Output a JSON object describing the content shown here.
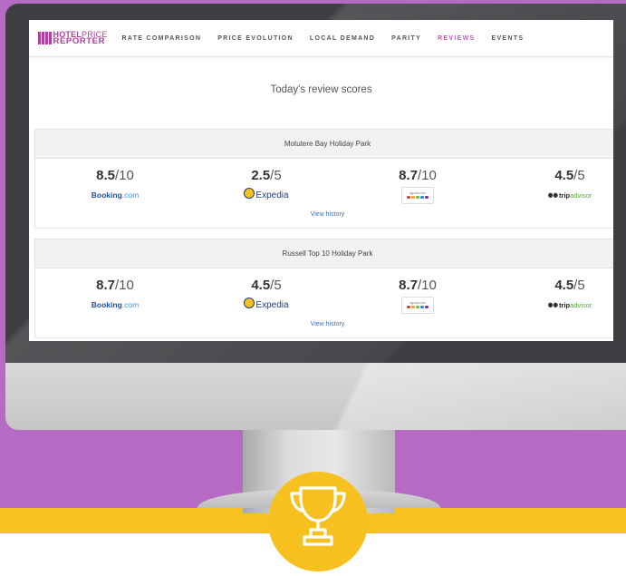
{
  "logo": {
    "line1_bold": "HOTEL",
    "line1_light": "PRICE",
    "line2": "REPORTER"
  },
  "nav": [
    {
      "label": "RATE COMPARISON",
      "active": false
    },
    {
      "label": "PRICE EVOLUTION",
      "active": false
    },
    {
      "label": "LOCAL DEMAND",
      "active": false
    },
    {
      "label": "PARITY",
      "active": false
    },
    {
      "label": "REVIEWS",
      "active": true
    },
    {
      "label": "EVENTS",
      "active": false
    }
  ],
  "page_title": "Today's review scores",
  "properties": [
    {
      "name": "Motutere Bay Holiday Park",
      "scores": [
        {
          "source": "booking-logo",
          "score": "8.5",
          "max": "/10"
        },
        {
          "source": "expedia-logo",
          "score": "2.5",
          "max": "/5"
        },
        {
          "source": "agoda-logo",
          "score": "8.7",
          "max": "/10"
        },
        {
          "source": "tripadvisor-logo",
          "score": "4.5",
          "max": "/5"
        }
      ],
      "view_history": "View history"
    },
    {
      "name": "Russell Top 10 Holiday Park",
      "scores": [
        {
          "source": "booking-logo",
          "score": "8.7",
          "max": "/10"
        },
        {
          "source": "expedia-logo",
          "score": "4.5",
          "max": "/5"
        },
        {
          "source": "agoda-logo",
          "score": "8.7",
          "max": "/10"
        },
        {
          "source": "tripadvisor-logo",
          "score": "4.5",
          "max": "/5"
        }
      ],
      "view_history": "View history"
    }
  ],
  "brands": {
    "booking": {
      "main": "Booking",
      "suffix": ".com"
    },
    "expedia": {
      "name": "Expedia"
    },
    "agoda": {
      "text": "agoda.com"
    },
    "tripadvisor": {
      "main": "trip",
      "suffix": "advisor"
    }
  },
  "colors": {
    "background": "#b56ac3",
    "accent": "#f7c21f",
    "brand": "#b23ea1",
    "active_nav": "#c55ab6",
    "link": "#3a72c7"
  },
  "icons": {
    "trophy": "trophy-icon"
  }
}
